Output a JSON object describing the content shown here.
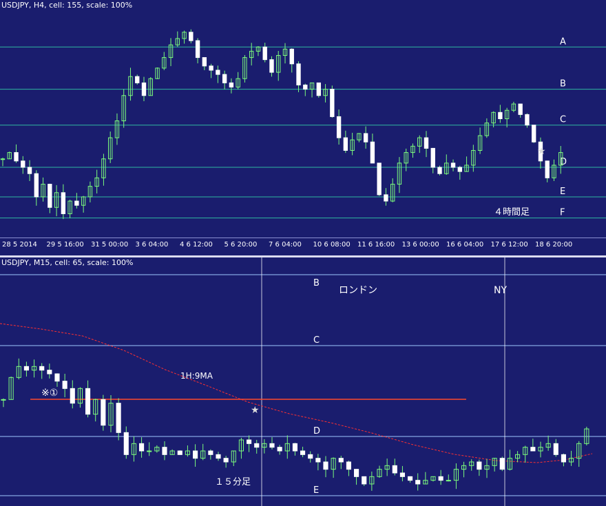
{
  "top_chart": {
    "title": "USDJPY, H4, cell: 155, scale: 100%",
    "timeframe_label": "４時間足",
    "levels": [
      {
        "name": "A",
        "price": 102.75
      },
      {
        "name": "B",
        "price": 102.55
      },
      {
        "name": "C",
        "price": 102.38
      },
      {
        "name": "D",
        "price": 102.18
      },
      {
        "name": "E",
        "price": 102.04
      },
      {
        "name": "F",
        "price": 101.94
      }
    ],
    "star_label": "★",
    "x_ticks": [
      "28 5 2014",
      "29 5 16:00",
      "31 5 00:00",
      "3 6 04:00",
      "4 6 12:00",
      "5 6 20:00",
      "7 6 04:00",
      "10 6 08:00",
      "11 6 16:00",
      "13 6 00:00",
      "16 6 04:00",
      "17 6 12:00",
      "18 6 20:00"
    ]
  },
  "bottom_chart": {
    "title": "USDJPY, M15, cell: 65, scale: 100%",
    "timeframe_label": "１５分足",
    "session_labels": [
      "ロンドン",
      "NY"
    ],
    "levels": [
      {
        "name": "B",
        "price": 102.55
      },
      {
        "name": "C",
        "price": 102.38
      },
      {
        "name": "D",
        "price": 102.1
      },
      {
        "name": "E",
        "price": 102.04
      }
    ],
    "ma_label": "1H:9MA",
    "marker_label": "※①",
    "star_label": "★"
  },
  "colors": {
    "background": "#1a1d6e",
    "bull_candle": "#ffffff",
    "bear_candle": "#ffffff",
    "wick": "#7CFC7C",
    "level_line_top": "#2fb8a0",
    "level_line_bottom": "#9fc6ff",
    "red_line": "#ff4a2a",
    "ma_line": "#ff3030",
    "session_line": "#ffffff"
  },
  "chart_data": [
    {
      "type": "candlestick",
      "title": "USDJPY, H4, cell: 155, scale: 100%",
      "ylim": [
        101.88,
        102.94
      ],
      "x": [
        "28 5 2014",
        "29 5 16:00",
        "31 5 00:00",
        "3 6 04:00",
        "4 6 12:00",
        "5 6 20:00",
        "7 6 04:00",
        "10 6 08:00",
        "11 6 16:00",
        "13 6 00:00",
        "16 6 04:00",
        "17 6 12:00",
        "18 6 20:00"
      ],
      "close_path": [
        102.22,
        102.25,
        102.21,
        102.18,
        102.15,
        102.04,
        102.1,
        101.99,
        102.06,
        101.96,
        102.02,
        102.0,
        102.04,
        102.09,
        102.13,
        102.22,
        102.32,
        102.4,
        102.52,
        102.61,
        102.58,
        102.52,
        102.6,
        102.65,
        102.7,
        102.76,
        102.79,
        102.82,
        102.78,
        102.7,
        102.66,
        102.64,
        102.62,
        102.58,
        102.56,
        102.6,
        102.7,
        102.73,
        102.75,
        102.69,
        102.63,
        102.71,
        102.74,
        102.67,
        102.57,
        102.55,
        102.58,
        102.52,
        102.55,
        102.42,
        102.32,
        102.26,
        102.31,
        102.34,
        102.3,
        102.2,
        102.05,
        102.02,
        102.1,
        102.2,
        102.25,
        102.28,
        102.32,
        102.27,
        102.18,
        102.15,
        102.2,
        102.18,
        102.16,
        102.19,
        102.26,
        102.33,
        102.39,
        102.44,
        102.41,
        102.45,
        102.48,
        102.43,
        102.38,
        102.3,
        102.21,
        102.13,
        102.19,
        102.25
      ]
    },
    {
      "type": "candlestick",
      "title": "USDJPY, M15, cell: 65, scale: 100%",
      "ylim": [
        102.02,
        102.62
      ],
      "series": [
        {
          "name": "1H:9MA",
          "type": "line"
        }
      ],
      "close_path": [
        102.28,
        102.34,
        102.37,
        102.36,
        102.37,
        102.36,
        102.35,
        102.33,
        102.31,
        102.27,
        102.31,
        102.24,
        102.28,
        102.21,
        102.27,
        102.19,
        102.13,
        102.16,
        102.14,
        102.14,
        102.15,
        102.13,
        102.14,
        102.13,
        102.14,
        102.12,
        102.14,
        102.13,
        102.12,
        102.11,
        102.14,
        102.17,
        102.16,
        102.15,
        102.16,
        102.15,
        102.14,
        102.16,
        102.14,
        102.13,
        102.12,
        102.11,
        102.09,
        102.12,
        102.11,
        102.09,
        102.07,
        102.05,
        102.07,
        102.09,
        102.1,
        102.08,
        102.07,
        102.06,
        102.05,
        102.06,
        102.07,
        102.06,
        102.06,
        102.09,
        102.1,
        102.11,
        102.09,
        102.1,
        102.12,
        102.09,
        102.12,
        102.13,
        102.15,
        102.14,
        102.15,
        102.16,
        102.13,
        102.11,
        102.12,
        102.16,
        102.2
      ]
    }
  ]
}
